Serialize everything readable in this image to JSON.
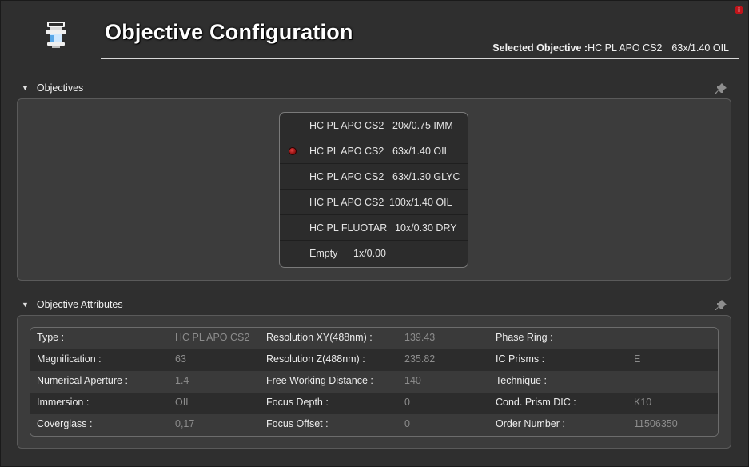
{
  "header": {
    "title": "Objective Configuration",
    "selected_label": "Selected Objective :",
    "selected_name": "HC PL APO CS2",
    "selected_spec": "63x/1.40 OIL",
    "info_badge": "i"
  },
  "sections": {
    "objectives_title": "Objectives",
    "attributes_title": "Objective Attributes"
  },
  "objectives": [
    {
      "name": "HC PL APO CS2",
      "spec": "20x/0.75 IMM",
      "active": false
    },
    {
      "name": "HC PL APO CS2",
      "spec": "63x/1.40 OIL",
      "active": true
    },
    {
      "name": "HC PL APO CS2",
      "spec": "63x/1.30 GLYC",
      "active": false
    },
    {
      "name": "HC PL APO CS2",
      "spec": "100x/1.40 OIL",
      "active": false
    },
    {
      "name": "HC PL FLUOTAR",
      "spec": "10x/0.30 DRY",
      "active": false
    },
    {
      "name": "Empty",
      "spec": "1x/0.00",
      "active": false
    }
  ],
  "attributes": [
    [
      {
        "label": "Type :",
        "value": "HC PL APO CS2"
      },
      {
        "label": "Resolution XY(488nm) :",
        "value": "139.43"
      },
      {
        "label": "Phase Ring :",
        "value": ""
      }
    ],
    [
      {
        "label": "Magnification :",
        "value": "63"
      },
      {
        "label": "Resolution Z(488nm) :",
        "value": "235.82"
      },
      {
        "label": "IC Prisms :",
        "value": "E"
      }
    ],
    [
      {
        "label": "Numerical Aperture :",
        "value": "1.4"
      },
      {
        "label": "Free Working Distance :",
        "value": "140"
      },
      {
        "label": "Technique :",
        "value": ""
      }
    ],
    [
      {
        "label": "Immersion :",
        "value": "OIL"
      },
      {
        "label": "Focus Depth :",
        "value": "0"
      },
      {
        "label": "Cond. Prism DIC :",
        "value": "K10"
      }
    ],
    [
      {
        "label": "Coverglass :",
        "value": "0,17"
      },
      {
        "label": "Focus Offset :",
        "value": "0"
      },
      {
        "label": "Order Number :",
        "value": "11506350"
      }
    ]
  ],
  "icons": {
    "app": "objective-lens-icon",
    "pin": "pin-icon",
    "collapse": "triangle-down-icon",
    "info": "info-icon"
  },
  "colors": {
    "active_dot": "#c01818",
    "info_badge": "#c0141a",
    "value_text": "#8c8c8c"
  }
}
